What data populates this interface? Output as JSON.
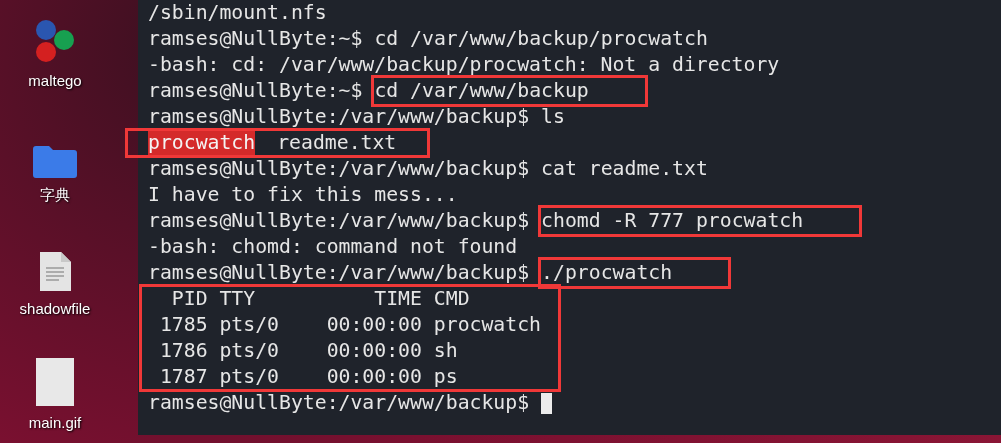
{
  "desktop_icons": [
    {
      "kind": "app",
      "label": "maltego"
    },
    {
      "kind": "folder",
      "label": "字典"
    },
    {
      "kind": "file",
      "label": "shadowfile"
    },
    {
      "kind": "image",
      "label": "main.gif"
    }
  ],
  "terminal": {
    "lines": [
      {
        "kind": "text",
        "text": "/sbin/mount.nfs"
      },
      {
        "kind": "command",
        "prompt": "ramses@NullByte:~$",
        "command": "cd /var/www/backup/procwatch",
        "annotated": false
      },
      {
        "kind": "text",
        "text": "-bash: cd: /var/www/backup/procwatch: Not a directory"
      },
      {
        "kind": "command",
        "prompt": "ramses@NullByte:~$",
        "command": "cd /var/www/backup",
        "annotated": true
      },
      {
        "kind": "command",
        "prompt": "ramses@NullByte:/var/www/backup$",
        "command": "ls",
        "annotated": false
      },
      {
        "kind": "listing",
        "entries": [
          {
            "text": "procwatch",
            "highlighted": true
          },
          {
            "text": "readme.txt",
            "highlighted": false
          }
        ]
      },
      {
        "kind": "command",
        "prompt": "ramses@NullByte:/var/www/backup$",
        "command": "cat readme.txt",
        "annotated": false
      },
      {
        "kind": "text",
        "text": "I have to fix this mess..."
      },
      {
        "kind": "command",
        "prompt": "ramses@NullByte:/var/www/backup$",
        "command": "chomd -R 777 procwatch",
        "annotated": true
      },
      {
        "kind": "text",
        "text": "-bash: chomd: command not found"
      },
      {
        "kind": "command",
        "prompt": "ramses@NullByte:/var/www/backup$",
        "command": "./procwatch",
        "annotated": true
      },
      {
        "kind": "text",
        "text": "  PID TTY          TIME CMD"
      },
      {
        "kind": "text",
        "text": " 1785 pts/0    00:00:00 procwatch"
      },
      {
        "kind": "text",
        "text": " 1786 pts/0    00:00:00 sh"
      },
      {
        "kind": "text",
        "text": " 1787 pts/0    00:00:00 ps"
      },
      {
        "kind": "prompt",
        "text": "ramses@NullByte:/var/www/backup$",
        "cursor": true
      }
    ]
  }
}
